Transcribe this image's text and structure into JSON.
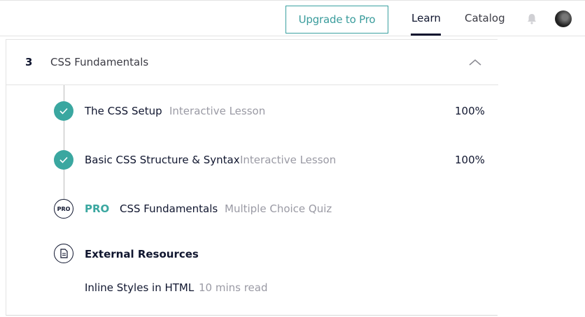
{
  "header": {
    "upgrade_label": "Upgrade to Pro",
    "nav": {
      "learn": "Learn",
      "catalog": "Catalog"
    },
    "icons": {
      "bell": "bell-icon",
      "avatar": "user-avatar"
    }
  },
  "section": {
    "number": "3",
    "title": "CSS Fundamentals",
    "expanded": true
  },
  "items": [
    {
      "title": "The CSS Setup",
      "type": "Interactive Lesson",
      "percent": "100%",
      "status": "complete"
    },
    {
      "title": "Basic CSS Structure & Syntax",
      "type": "Interactive Lesson",
      "percent": "100%",
      "status": "complete"
    },
    {
      "pro_label": "PRO",
      "icon_text": "PRO",
      "title": "CSS Fundamentals",
      "type": "Multiple Choice Quiz",
      "status": "locked"
    }
  ],
  "external": {
    "title": "External Resources",
    "resources": [
      {
        "title": "Inline Styles in HTML",
        "meta": "10 mins read"
      }
    ]
  },
  "colors": {
    "accent": "#3aa7a0",
    "text": "#10162f",
    "muted": "#9a9aa4"
  }
}
